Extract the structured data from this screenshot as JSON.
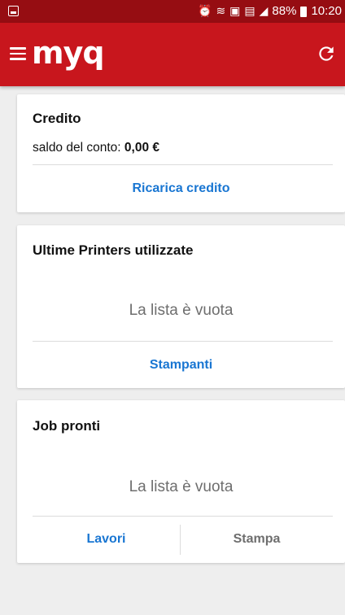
{
  "status_bar": {
    "battery": "88%",
    "time": "10:20",
    "icons": [
      "alarm-icon",
      "wifi-icon",
      "nfc-icon",
      "sim-icon",
      "signal-icon",
      "battery-icon"
    ]
  },
  "app_bar": {
    "logo": "myq",
    "icons": [
      "menu-icon",
      "refresh-icon"
    ]
  },
  "credit_card": {
    "title": "Credito",
    "balance_label": "saldo del conto: ",
    "balance_value": "0,00 €",
    "action": "Ricarica credito"
  },
  "printers_card": {
    "title": "Ultime Printers utilizzate",
    "empty": "La lista è vuota",
    "action": "Stampanti"
  },
  "jobs_card": {
    "title": "Job pronti",
    "empty": "La lista è vuota",
    "action_left": "Lavori",
    "action_right": "Stampa"
  },
  "colors": {
    "status_bar": "#960d12",
    "app_bar": "#c8161d",
    "link": "#1976d2",
    "muted": "#6e6e6e",
    "background": "#eeeeee"
  }
}
